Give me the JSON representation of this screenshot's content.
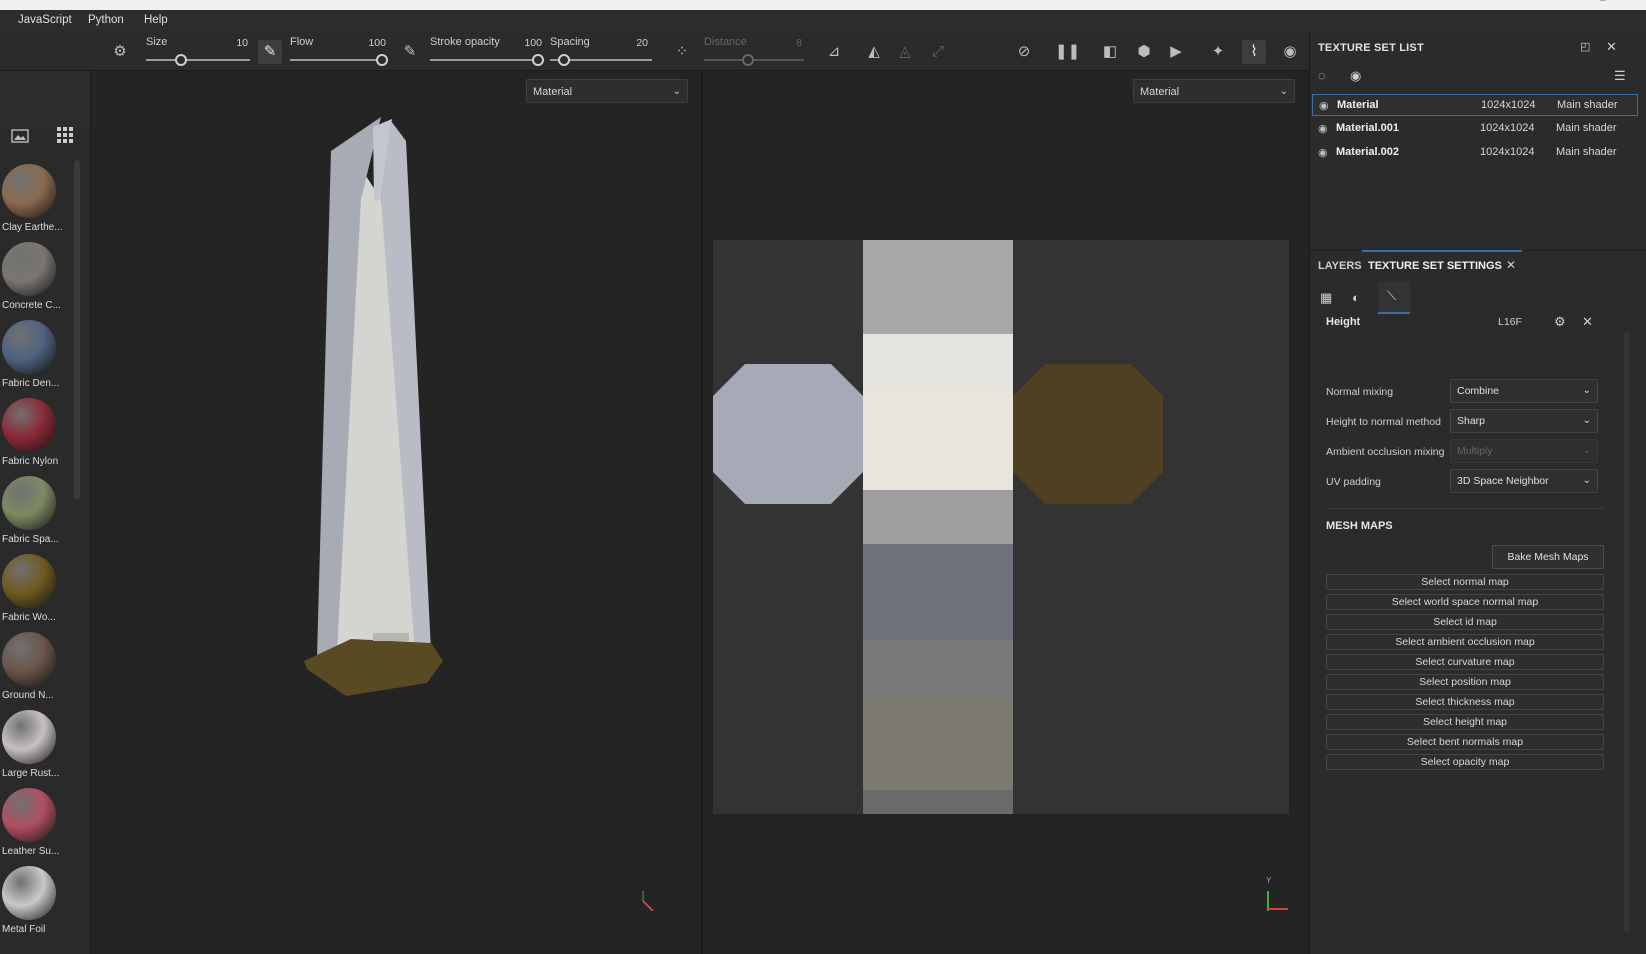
{
  "menu": [
    "JavaScript",
    "Python",
    "Help"
  ],
  "toolbar": {
    "size_label": "Size",
    "size_value": "10",
    "flow_label": "Flow",
    "flow_value": "100",
    "stroke_label": "Stroke opacity",
    "stroke_value": "100",
    "spacing_label": "Spacing",
    "spacing_value": "20",
    "distance_label": "Distance",
    "distance_value": "8"
  },
  "shelf": {
    "materials": [
      {
        "label": "Clay Earthe...",
        "color": "#8b6a4e"
      },
      {
        "label": "Concrete C...",
        "color": "#7a7670"
      },
      {
        "label": "Fabric Den...",
        "color": "#4f6280"
      },
      {
        "label": "Fabric Nylon",
        "color": "#8a2a36"
      },
      {
        "label": "Fabric Spa...",
        "color": "#7c8a62"
      },
      {
        "label": "Fabric Wo...",
        "color": "#6e5a1f"
      },
      {
        "label": "Ground N...",
        "color": "#6a554a"
      },
      {
        "label": "Large Rust...",
        "color": "#c8c0c0"
      },
      {
        "label": "Leather Su...",
        "color": "#b04e62"
      },
      {
        "label": "Metal Foil",
        "color": "#c9c9c9"
      }
    ]
  },
  "viewports": {
    "left_select": "Material",
    "right_select": "Material"
  },
  "texture_set_list": {
    "title": "TEXTURE SET LIST",
    "rows": [
      {
        "name": "Material",
        "res": "1024x1024",
        "shader": "Main shader"
      },
      {
        "name": "Material.001",
        "res": "1024x1024",
        "shader": "Main shader"
      },
      {
        "name": "Material.002",
        "res": "1024x1024",
        "shader": "Main shader"
      }
    ]
  },
  "tabs": {
    "layers": "LAYERS",
    "texture_set_settings": "TEXTURE SET SETTINGS"
  },
  "settings": {
    "height_label": "Height",
    "height_format": "L16F",
    "normal_mixing_label": "Normal mixing",
    "normal_mixing_value": "Combine",
    "h2n_label": "Height to normal method",
    "h2n_value": "Sharp",
    "ao_mixing_label": "Ambient occlusion mixing",
    "ao_mixing_value": "Multiply",
    "uv_padding_label": "UV padding",
    "uv_padding_value": "3D Space Neighbor",
    "mesh_maps_title": "MESH MAPS",
    "bake_button": "Bake Mesh Maps",
    "mesh_buttons": [
      "Select normal map",
      "Select world space normal map",
      "Select id map",
      "Select ambient occlusion map",
      "Select curvature map",
      "Select position map",
      "Select thickness map",
      "Select height map",
      "Select bent normals map",
      "Select opacity map"
    ]
  },
  "axis": {
    "y": "Y"
  }
}
